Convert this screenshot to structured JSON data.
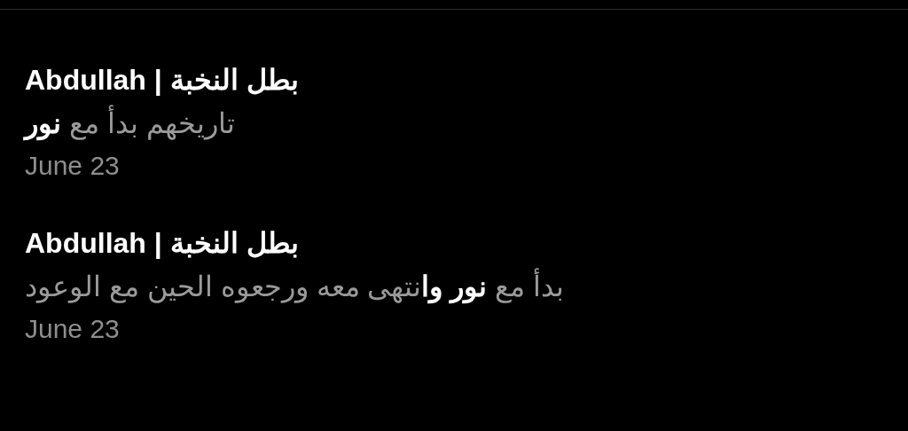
{
  "messages": [
    {
      "sender": "Abdullah | بطل النخبة",
      "text": "تاريخهم بدأ مع **نور**",
      "date": "June 23"
    },
    {
      "sender": "Abdullah | بطل النخبة",
      "text": "بدأ مع **نور وا**نتهى معه ورجعوه الحين مع الوعود",
      "date": "June 23"
    }
  ]
}
